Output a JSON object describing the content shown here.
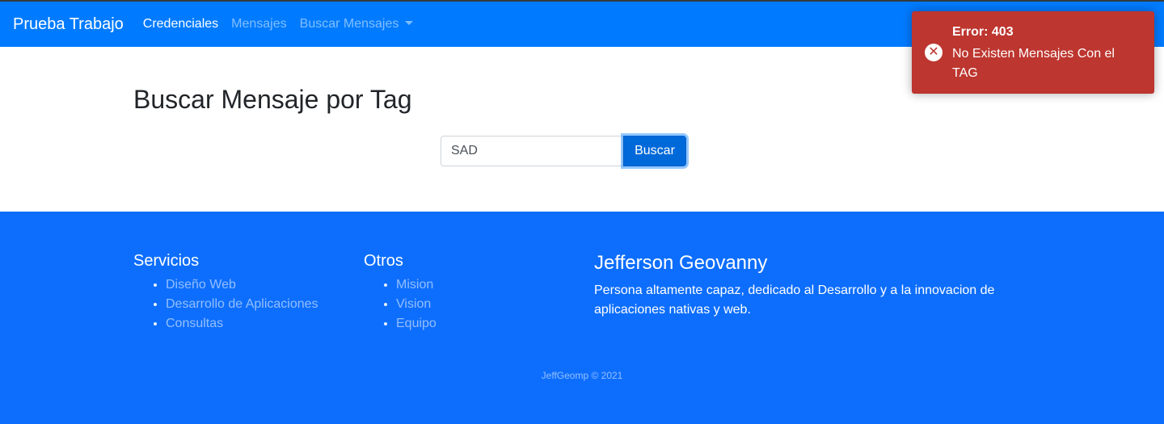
{
  "navbar": {
    "brand": "Prueba Trabajo",
    "links": [
      {
        "label": "Credenciales"
      },
      {
        "label": "Mensajes"
      },
      {
        "label": "Buscar Mensajes"
      }
    ]
  },
  "main": {
    "title": "Buscar Mensaje por Tag",
    "search": {
      "value": "SAD",
      "button_label": "Buscar"
    }
  },
  "footer": {
    "services": {
      "title": "Servicios",
      "items": [
        "Diseño Web",
        "Desarrollo de Aplicaciones",
        "Consultas"
      ]
    },
    "others": {
      "title": "Otros",
      "items": [
        "Mision",
        "Vision",
        "Equipo"
      ]
    },
    "about": {
      "name": "Jefferson Geovanny",
      "description": "Persona altamente capaz, dedicado al Desarrollo y a la innovacion de aplicaciones nativas y web."
    },
    "copyright": "JeffGeomp © 2021"
  },
  "toast": {
    "title": "Error: 403",
    "message": "No Existen Mensajes Con el TAG",
    "icon": "error-circle-icon"
  },
  "colors": {
    "navbar": "#007bff",
    "footer": "#0d6efd",
    "primary_button": "#0069d9",
    "error_toast": "#bd362f"
  }
}
